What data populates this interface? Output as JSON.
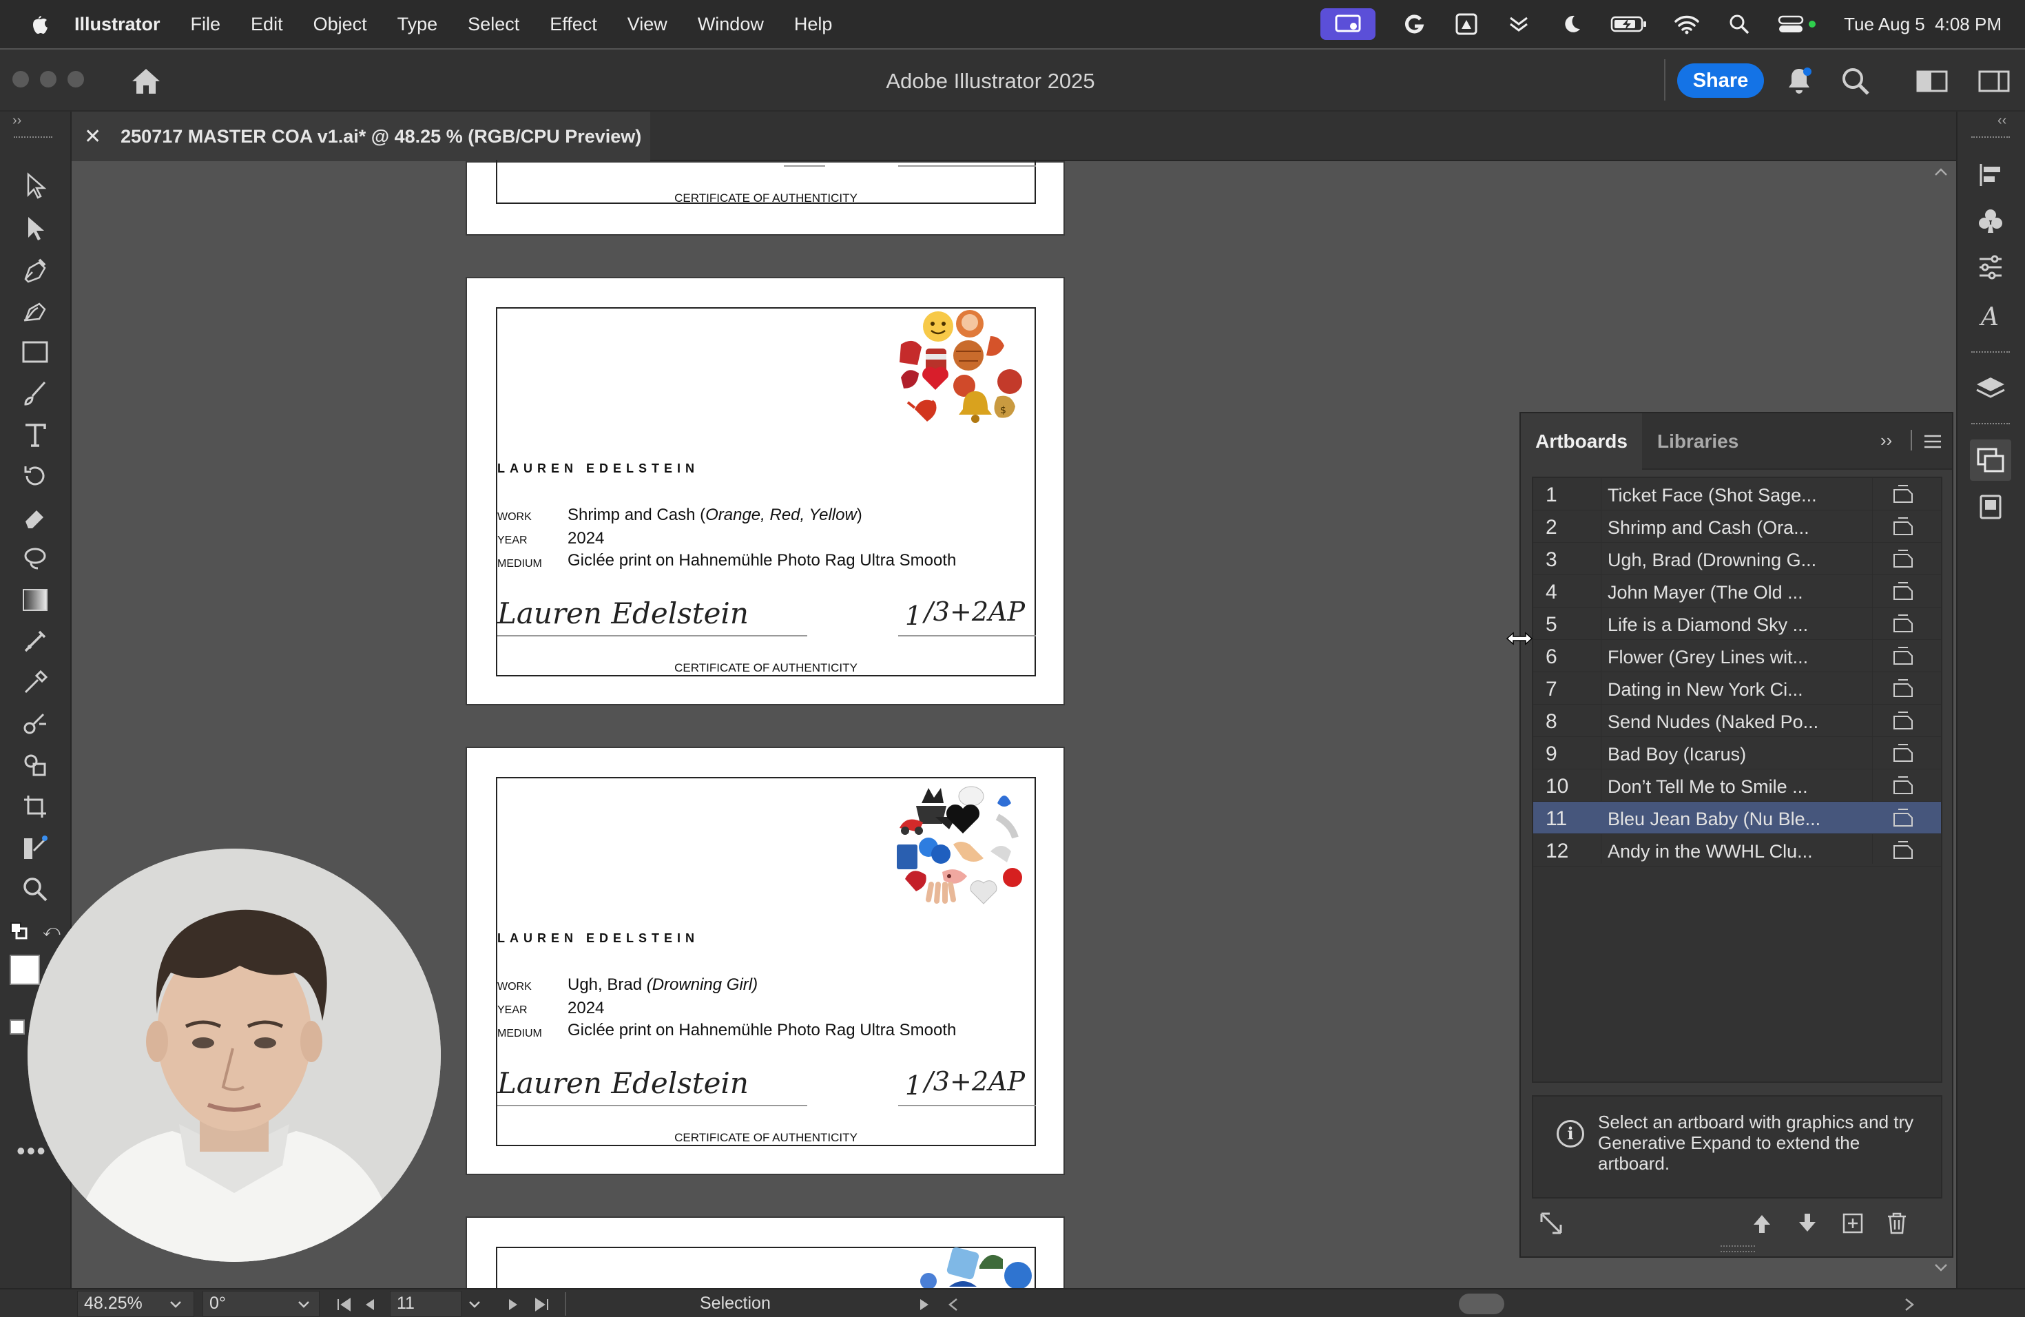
{
  "menubar": {
    "app_name": "Illustrator",
    "items": [
      "File",
      "Edit",
      "Object",
      "Type",
      "Select",
      "Effect",
      "View",
      "Window",
      "Help"
    ],
    "clock": "Tue Aug 5  4:08 PM"
  },
  "titlebar": {
    "title": "Adobe Illustrator 2025",
    "share_label": "Share"
  },
  "document": {
    "tab_title": "250717 MASTER COA v1.ai* @ 48.25 % (RGB/CPU Preview)"
  },
  "certificates": {
    "artist": "LAUREN EDELSTEIN",
    "work_label": "WORK",
    "year_label": "YEAR",
    "medium_label": "MEDIUM",
    "footer": "CERTIFICATE OF AUTHENTICITY",
    "signature": "Lauren Edelstein",
    "edition_number": "1",
    "edition_size": "/3+2AP",
    "card2": {
      "work_plain": "Shrimp and Cash (",
      "work_italic": "Orange, Red, Yellow",
      "work_close": ")",
      "year": "2024",
      "medium": "Giclée print on Hahnemühle Photo Rag Ultra Smooth"
    },
    "card3": {
      "work_plain": "Ugh, Brad ",
      "work_italic": "(Drowning Girl)",
      "year": "2024",
      "medium": "Giclée print on Hahnemühle Photo Rag Ultra Smooth"
    }
  },
  "panel": {
    "tab_artboards": "Artboards",
    "tab_libraries": "Libraries",
    "selected_index": 11,
    "artboards": [
      {
        "num": "1",
        "name": "Ticket Face (Shot Sage..."
      },
      {
        "num": "2",
        "name": "Shrimp and Cash (Ora..."
      },
      {
        "num": "3",
        "name": "Ugh, Brad (Drowning G..."
      },
      {
        "num": "4",
        "name": "John Mayer (The Old ..."
      },
      {
        "num": "5",
        "name": "Life is a Diamond Sky ..."
      },
      {
        "num": "6",
        "name": "Flower (Grey Lines wit..."
      },
      {
        "num": "7",
        "name": "Dating in New York Ci..."
      },
      {
        "num": "8",
        "name": "Send Nudes (Naked Po..."
      },
      {
        "num": "9",
        "name": "Bad Boy (Icarus)"
      },
      {
        "num": "10",
        "name": "Don’t Tell Me to Smile ..."
      },
      {
        "num": "11",
        "name": "Bleu Jean Baby (Nu Ble..."
      },
      {
        "num": "12",
        "name": "Andy in the WWHL Clu..."
      }
    ],
    "hint": "Select an artboard with graphics and try Generative Expand to extend the artboard."
  },
  "statusbar": {
    "zoom": "48.25%",
    "rotation": "0°",
    "artboard_number": "11",
    "tool": "Selection"
  },
  "colors": {
    "accent": "#1473e6",
    "selection": "#46567c",
    "recording": "#5b4fd8"
  }
}
